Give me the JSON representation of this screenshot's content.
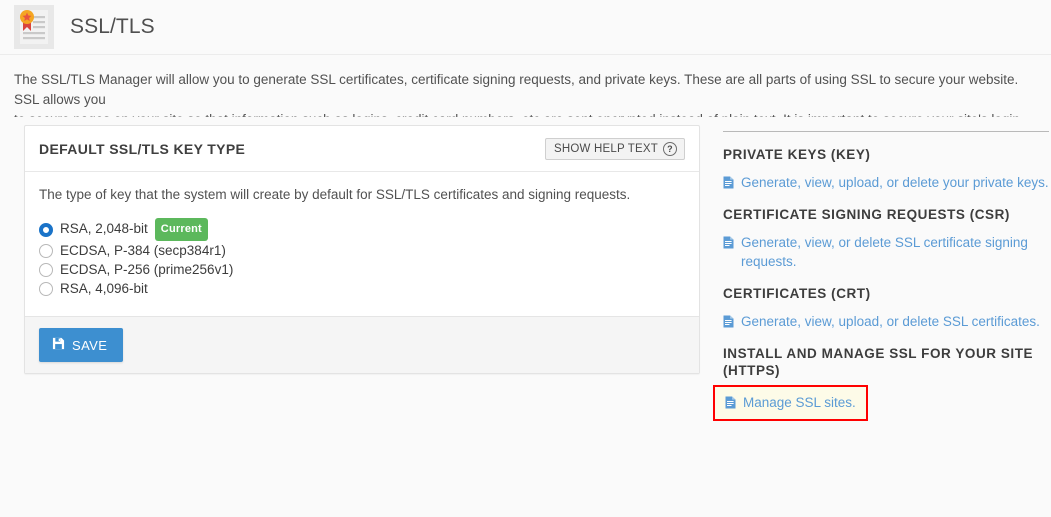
{
  "header": {
    "title": "SSL/TLS",
    "icon": "certificate-icon"
  },
  "intro": {
    "text": "The SSL/TLS Manager will allow you to generate SSL certificates, certificate signing requests, and private keys. These are all parts of using SSL to secure your website. SSL allows you\nto secure pages on your site so that information such as logins, credit card numbers, etc are sent encrypted instead of plain text. It is important to secure your site's login areas,\nshopping areas, and other pages where sensitive information could be sent over the web."
  },
  "panel": {
    "title": "DEFAULT SSL/TLS KEY TYPE",
    "help_button_label": "SHOW HELP TEXT",
    "help_icon": "question-circle-icon",
    "description": "The type of key that the system will create by default for SSL/TLS certificates and signing requests.",
    "options": [
      {
        "label": "RSA, 2,048-bit",
        "selected": true,
        "badge": "Current"
      },
      {
        "label": "ECDSA, P-384 (secp384r1)",
        "selected": false,
        "badge": ""
      },
      {
        "label": "ECDSA, P-256 (prime256v1)",
        "selected": false,
        "badge": ""
      },
      {
        "label": "RSA, 4,096-bit",
        "selected": false,
        "badge": ""
      }
    ],
    "save_label": "SAVE",
    "save_icon": "floppy-disk-icon"
  },
  "sidebar": {
    "sections": [
      {
        "title": "PRIVATE KEYS (KEY)",
        "link": "Generate, view, upload, or delete your private keys.",
        "link_icon": "document-icon",
        "highlighted": false
      },
      {
        "title": "CERTIFICATE SIGNING REQUESTS (CSR)",
        "link": "Generate, view, or delete SSL certificate signing requests.",
        "link_icon": "document-icon",
        "highlighted": false
      },
      {
        "title": "CERTIFICATES (CRT)",
        "link": "Generate, view, upload, or delete SSL certificates.",
        "link_icon": "document-icon",
        "highlighted": false
      },
      {
        "title": "INSTALL AND MANAGE SSL FOR YOUR SITE (HTTPS)",
        "link": "Manage SSL sites.",
        "link_icon": "document-icon",
        "highlighted": true
      }
    ]
  },
  "colors": {
    "primary_button": "#3d8fd0",
    "link": "#5b9bd5",
    "badge_green": "#5cb85c",
    "radio_selected": "#1a73c8",
    "highlight_border": "#ff0000",
    "highlight_background": "#fdfbe8"
  }
}
